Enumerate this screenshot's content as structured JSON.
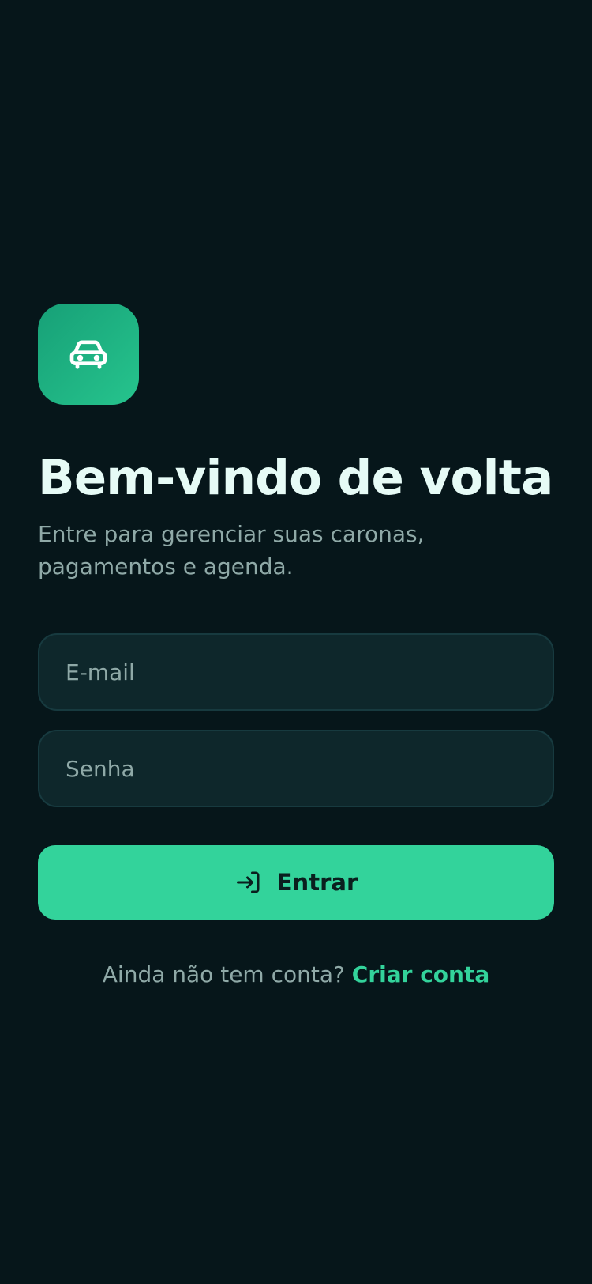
{
  "app": {
    "logo_icon": "car-icon",
    "accent_color": "#33d39b"
  },
  "header": {
    "title": "Bem-vindo de volta",
    "subtitle": "Entre para gerenciar suas caronas, pagamentos e agenda."
  },
  "form": {
    "email_placeholder": "E-mail",
    "password_placeholder": "Senha",
    "submit_label": "Entrar",
    "submit_icon": "login-icon"
  },
  "footer": {
    "prompt": "Ainda não tem conta?",
    "link_label": "Criar conta"
  }
}
